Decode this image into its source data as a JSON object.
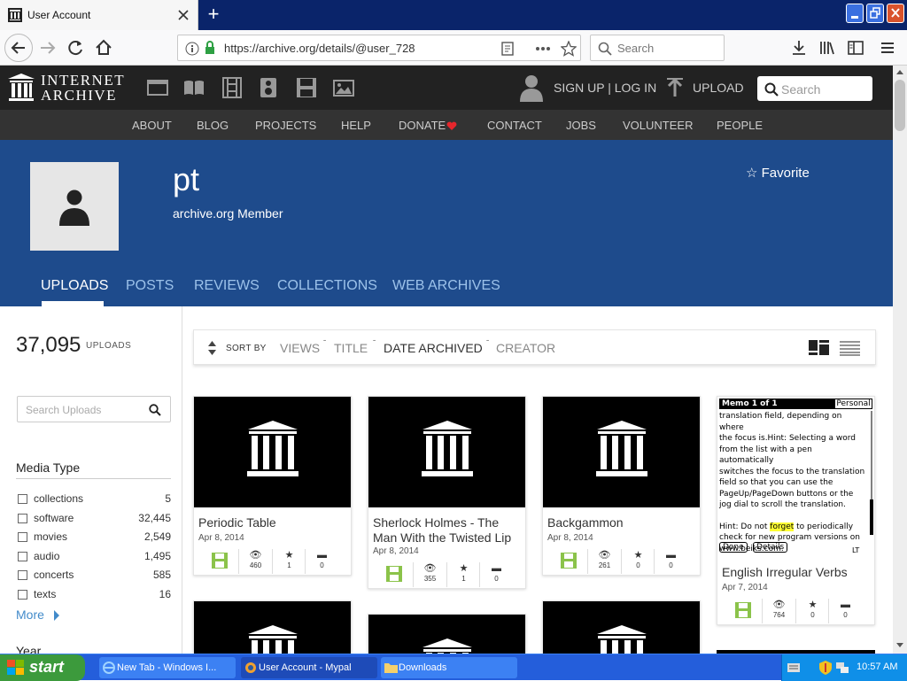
{
  "browser": {
    "tab_title": "User Account",
    "url": "https://archive.org/details/@user_728",
    "search_placeholder": "Search"
  },
  "ia_header": {
    "logo_line1": "INTERNET",
    "logo_line2": "ARCHIVE",
    "signup": "SIGN UP | LOG IN",
    "upload": "UPLOAD",
    "search_placeholder": "Search",
    "nav": [
      "ABOUT",
      "BLOG",
      "PROJECTS",
      "HELP",
      "DONATE",
      "CONTACT",
      "JOBS",
      "VOLUNTEER",
      "PEOPLE"
    ]
  },
  "profile": {
    "name": "pt",
    "subtitle": "archive.org Member",
    "favorite": "Favorite",
    "tabs": [
      "UPLOADS",
      "POSTS",
      "REVIEWS",
      "COLLECTIONS",
      "WEB ARCHIVES"
    ]
  },
  "sidebar": {
    "count": "37,095",
    "count_label": "UPLOADS",
    "search_placeholder": "Search Uploads",
    "media_type_title": "Media Type",
    "facets": [
      {
        "label": "collections",
        "count": "5"
      },
      {
        "label": "software",
        "count": "32,445"
      },
      {
        "label": "movies",
        "count": "2,549"
      },
      {
        "label": "audio",
        "count": "1,495"
      },
      {
        "label": "concerts",
        "count": "585"
      },
      {
        "label": "texts",
        "count": "16"
      }
    ],
    "more": "More",
    "year_title": "Year"
  },
  "sort": {
    "label": "SORT BY",
    "options": [
      "VIEWS",
      "TITLE",
      "DATE ARCHIVED",
      "CREATOR"
    ]
  },
  "items": [
    {
      "title": "Periodic Table",
      "date": "Apr 8, 2014",
      "views": "460",
      "favs": "1",
      "reviews": "0"
    },
    {
      "title": "Sherlock Holmes - The Man With the Twisted Lip",
      "date": "Apr 8, 2014",
      "views": "355",
      "favs": "1",
      "reviews": "0"
    },
    {
      "title": "Backgammon",
      "date": "Apr 8, 2014",
      "views": "261",
      "favs": "0",
      "reviews": "0"
    },
    {
      "title": "English Irregular Verbs",
      "date": "Apr 7, 2014",
      "views": "764",
      "favs": "0",
      "reviews": "0"
    }
  ],
  "memo": {
    "title": "Memo 1 of 1",
    "category": "Personal",
    "lines": [
      "translation field, depending on where",
      "the focus is.Hint: Selecting a word",
      "from the list with a pen automatically",
      "switches the focus to the translation",
      "field so that you can use the",
      "PageUp/PageDown buttons or the",
      "jog dial to scroll the translation."
    ],
    "hint_pre": "Hint: Do not ",
    "hint_highlight": "forget",
    "hint_post": " to periodically",
    "hint_lines": [
      "check for new program versions on",
      "www.beiks.com."
    ],
    "done": "Done",
    "details": "Details",
    "lt": "LT"
  },
  "taskbar": {
    "start": "start",
    "tasks": [
      "New Tab - Windows I...",
      "User Account - Mypal",
      "Downloads"
    ],
    "clock": "10:57 AM"
  },
  "colors": {
    "profile_bg": "#1e4b8c",
    "header_bg": "#222222",
    "nav_bg": "#333333",
    "link": "#428bca",
    "taskbar": "#245edb",
    "start_green": "#3c9a3c"
  }
}
